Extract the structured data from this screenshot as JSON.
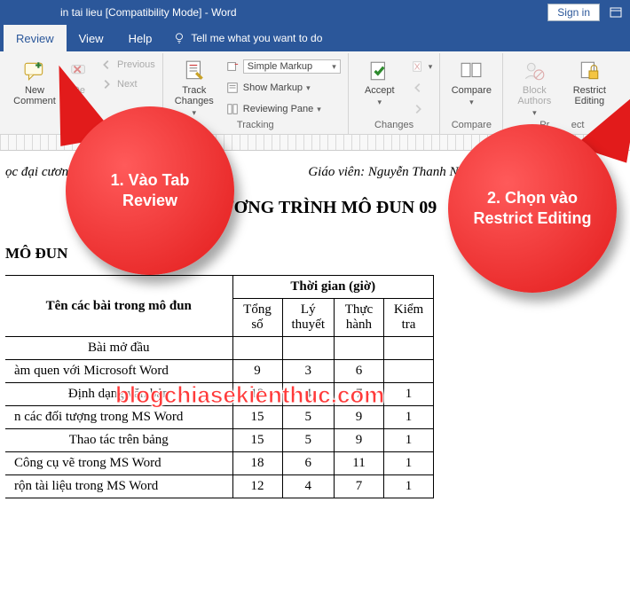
{
  "titlebar": {
    "title": "in tai lieu [Compatibility Mode]  -  Word",
    "signin": "Sign in"
  },
  "tabs": {
    "review": "Review",
    "view": "View",
    "help": "Help",
    "tellme": "Tell me what you want to do"
  },
  "ribbon": {
    "comments": {
      "new": "New\nComment",
      "delete": "De",
      "previous": "Previous",
      "next": "Next",
      "label": "Co"
    },
    "tracking": {
      "track": "Track\nChanges",
      "markup_selected": "Simple Markup",
      "show_markup": "Show Markup",
      "reviewing_pane": "Reviewing Pane",
      "label": "Tracking"
    },
    "changes": {
      "accept": "Accept",
      "label": "Changes"
    },
    "compare": {
      "compare": "Compare",
      "label": "Compare"
    },
    "protect": {
      "block": "Block\nAuthors",
      "restrict": "Restrict\nEditing",
      "label": "Pr        ect"
    }
  },
  "doc": {
    "left_meta": "ọc đại cương",
    "right_meta": "Giáo viên: Nguyễn Thanh Ng",
    "chapter": "CHƯƠNG TRÌNH MÔ ĐUN 09",
    "section": "MÔ ĐUN",
    "table": {
      "h_name": "Tên các bài trong mô đun",
      "h_time": "Thời gian (giờ)",
      "h_total": "Tổng số",
      "h_theory": "Lý thuyết",
      "h_practice": "Thực hành",
      "h_test": "Kiểm tra",
      "rows": [
        {
          "name": "Bài mở đầu",
          "total": "",
          "theory": "",
          "practice": "",
          "test": ""
        },
        {
          "name": "àm quen với Microsoft Word",
          "total": "9",
          "theory": "3",
          "practice": "6",
          "test": ""
        },
        {
          "name": "Định dạng văn bản",
          "total": "12",
          "theory": "4",
          "practice": "7",
          "test": "1"
        },
        {
          "name": "n các đối tượng trong MS Word",
          "total": "15",
          "theory": "5",
          "practice": "9",
          "test": "1"
        },
        {
          "name": "Thao tác trên bảng",
          "total": "15",
          "theory": "5",
          "practice": "9",
          "test": "1"
        },
        {
          "name": "Công cụ vẽ trong MS Word",
          "total": "18",
          "theory": "6",
          "practice": "11",
          "test": "1"
        },
        {
          "name": "rộn tài liệu trong MS Word",
          "total": "12",
          "theory": "4",
          "practice": "7",
          "test": "1"
        }
      ]
    }
  },
  "callouts": {
    "c1": "1. Vào Tab Review",
    "c2": "2. Chọn vào Restrict Editing"
  },
  "watermark": "blogchiasekienthuc.com"
}
